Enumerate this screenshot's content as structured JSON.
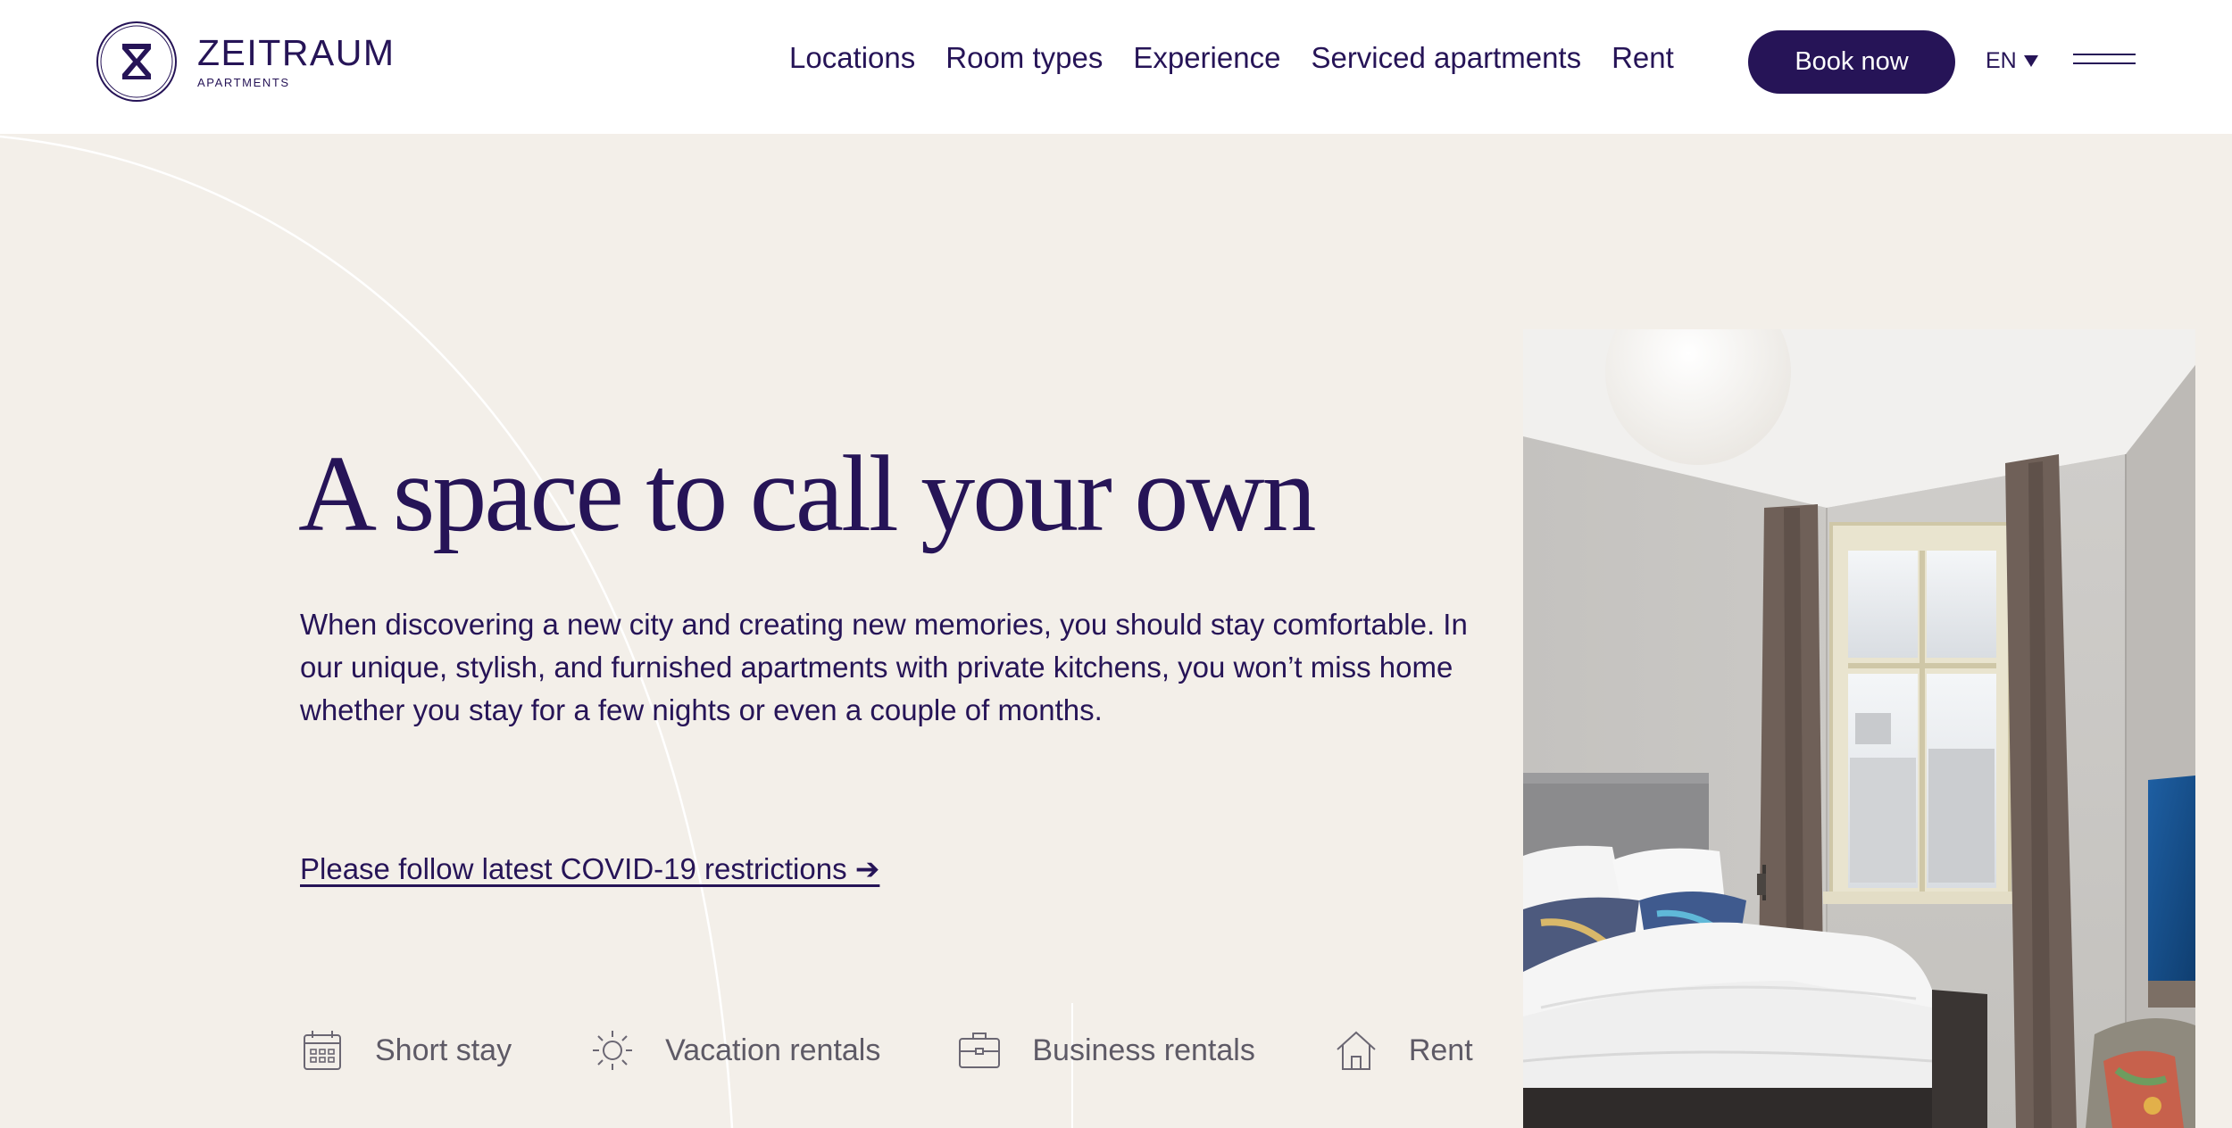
{
  "brand": {
    "name": "ZEITRAUM",
    "subtitle": "APARTMENTS"
  },
  "nav": {
    "items": [
      {
        "label": "Locations"
      },
      {
        "label": "Room types"
      },
      {
        "label": "Experience"
      },
      {
        "label": "Serviced apartments"
      },
      {
        "label": "Rent"
      }
    ],
    "book_label": "Book now",
    "language": "EN"
  },
  "hero": {
    "title": "A space to call your own",
    "description": "When discovering a new city and creating new memories, you should stay comfortable. In our unique, stylish, and furnished apartments with private kitchens, you won’t miss home whether you stay for a few nights or even a couple of months.",
    "covid_link": "Please follow latest COVID-19 restrictions ➔"
  },
  "features": [
    {
      "label": "Short stay",
      "icon": "calendar-icon"
    },
    {
      "label": "Vacation rentals",
      "icon": "sun-icon"
    },
    {
      "label": "Business rentals",
      "icon": "briefcase-icon"
    },
    {
      "label": "Rent",
      "icon": "house-icon"
    }
  ],
  "colors": {
    "brand_purple": "#261457",
    "page_background": "#f3efe9",
    "header_background": "#ffffff",
    "feature_text": "#5e5a66"
  }
}
